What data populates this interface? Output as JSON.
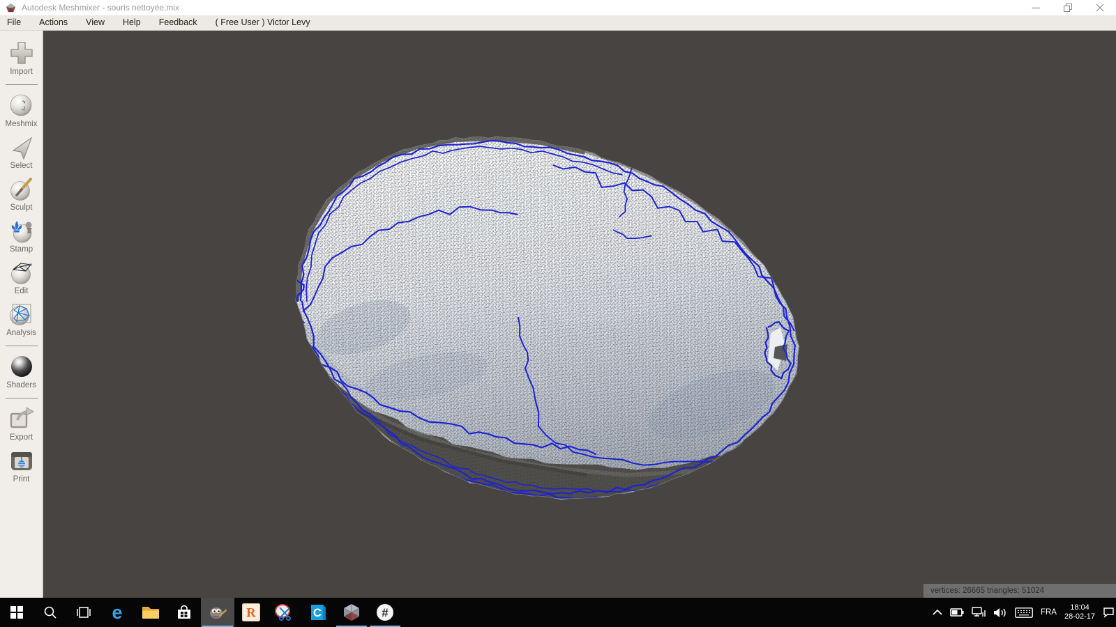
{
  "window": {
    "title": "Autodesk Meshmixer - souris nettoyée.mix",
    "controls": [
      "minimize",
      "restore",
      "close"
    ]
  },
  "menu": {
    "items": [
      "File",
      "Actions",
      "View",
      "Help",
      "Feedback",
      "( Free User ) Victor Levy"
    ]
  },
  "sidebar": {
    "tools": [
      "Import",
      "Meshmix",
      "Select",
      "Sculpt",
      "Stamp",
      "Edit",
      "Analysis",
      "Shaders",
      "Export",
      "Print"
    ]
  },
  "viewport": {
    "status_text": "vertices: 26665 triangles: 51024"
  },
  "taskbar": {
    "app_icons": [
      "start",
      "search",
      "task-view",
      "edge",
      "file-explorer",
      "store",
      "gimp",
      "revit",
      "snipping-scissors",
      "cura",
      "meshmixer",
      "hash-app"
    ],
    "letters": {
      "edge": "e",
      "revit": "R",
      "cura": "C",
      "hash": "#"
    },
    "tray_icons": [
      "chevron-up",
      "battery",
      "network",
      "volume",
      "keyboard",
      "action-center"
    ],
    "language": "FRA",
    "time": "18:04",
    "date": "28-02-17"
  },
  "colors": {
    "selection_blue": "#1d23d2",
    "viewport_bg": "#474442",
    "menubar_bg": "#edeae3",
    "status_chip_bg": "#6f6f6f",
    "taskbar_bg": "#060606"
  }
}
